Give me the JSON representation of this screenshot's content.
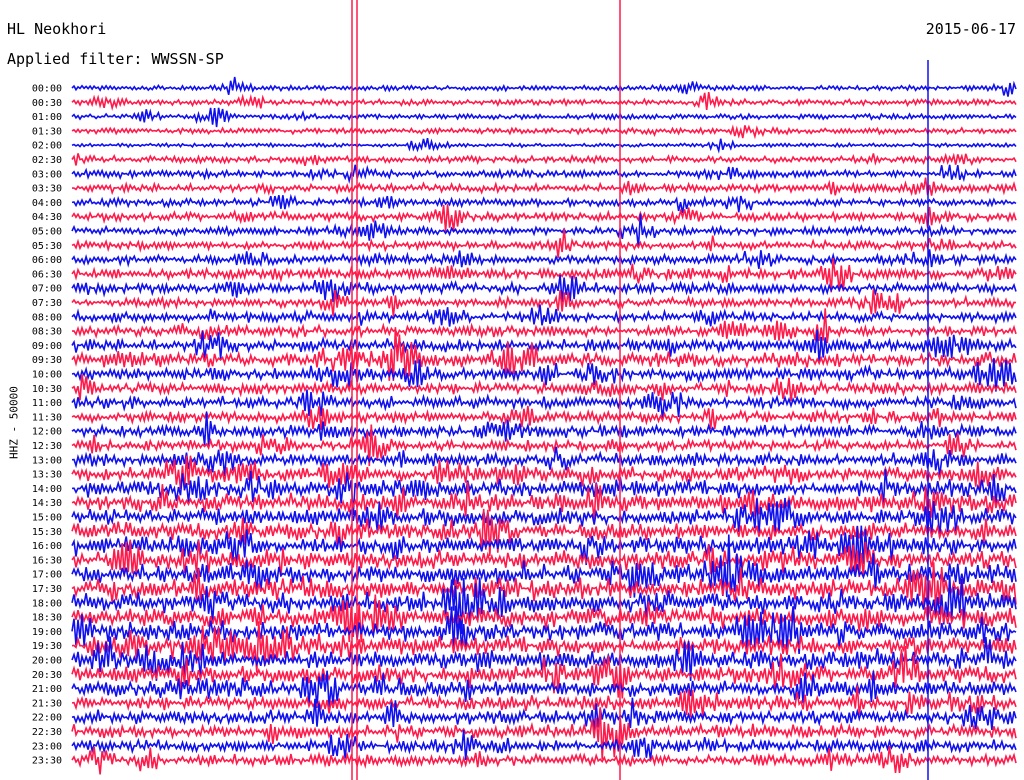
{
  "header": {
    "station": "HL Neokhori",
    "filter": "Applied filter: WWSSN-SP",
    "date": "2015-06-17"
  },
  "colors": {
    "trace_a": "#1010ee",
    "trace_b": "#ff1a4a",
    "text": "#000000"
  },
  "chart_data": {
    "type": "line",
    "ylabel": "HHZ - 50000",
    "row_labels": [
      "00:00",
      "00:30",
      "01:00",
      "01:30",
      "02:00",
      "02:30",
      "03:00",
      "03:30",
      "04:00",
      "04:30",
      "05:00",
      "05:30",
      "06:00",
      "06:30",
      "07:00",
      "07:30",
      "08:00",
      "08:30",
      "09:00",
      "09:30",
      "10:00",
      "10:30",
      "11:00",
      "11:30",
      "12:00",
      "12:30",
      "13:00",
      "13:30",
      "14:00",
      "14:30",
      "15:00",
      "15:30",
      "16:00",
      "16:30",
      "17:00",
      "17:30",
      "18:00",
      "18:30",
      "19:00",
      "19:30",
      "20:00",
      "20:30",
      "21:00",
      "21:30",
      "22:00",
      "22:30",
      "23:00",
      "23:30"
    ],
    "row_activity": [
      0.15,
      0.2,
      0.15,
      0.18,
      0.08,
      0.25,
      0.3,
      0.35,
      0.3,
      0.35,
      0.35,
      0.35,
      0.4,
      0.5,
      0.45,
      0.4,
      0.45,
      0.5,
      0.6,
      0.7,
      0.6,
      0.55,
      0.55,
      0.5,
      0.55,
      0.5,
      0.6,
      0.75,
      0.85,
      0.9,
      0.8,
      0.85,
      0.9,
      0.95,
      1.0,
      1.0,
      1.0,
      1.0,
      1.0,
      0.95,
      0.9,
      0.85,
      0.75,
      0.7,
      0.65,
      0.6,
      0.55,
      0.5
    ],
    "series_colors": [
      "blue",
      "red"
    ],
    "grid": false
  }
}
